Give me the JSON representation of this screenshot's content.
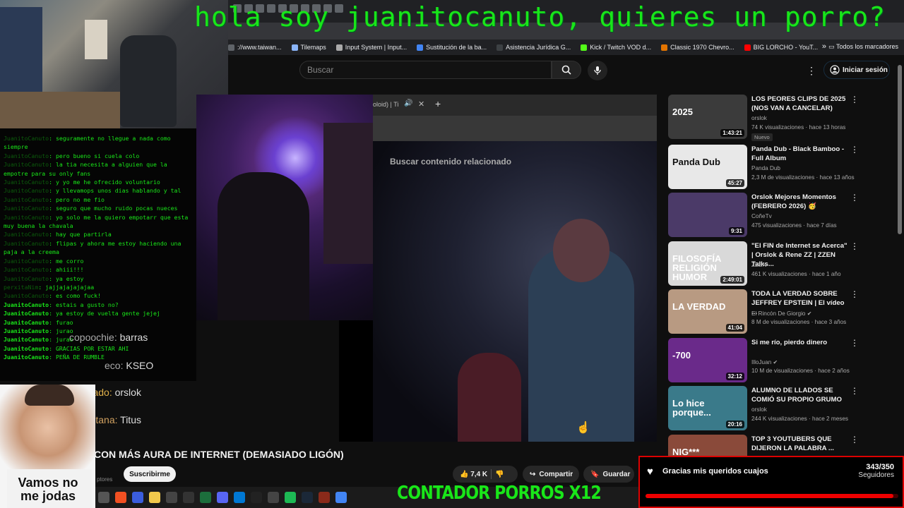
{
  "overlay_title": "hola soy juanitocanuto, quieres un porro?",
  "browser": {
    "bookmarks": [
      {
        "label": "://www.taiwan...",
        "color": "#5f6368"
      },
      {
        "label": "Tilemaps",
        "color": "#8ab4f8"
      },
      {
        "label": "Input System | Input...",
        "color": "#aaaaaa"
      },
      {
        "label": "Sustitución de la ba...",
        "color": "#4285f4"
      },
      {
        "label": "Asistencia Jurídica G...",
        "color": "#3c4043"
      },
      {
        "label": "Kick / Twitch VOD d...",
        "color": "#53fc18"
      },
      {
        "label": "Classic 1970 Chevro...",
        "color": "#e37400"
      },
      {
        "label": "BIG LORCHO - YouT...",
        "color": "#ff0000"
      }
    ],
    "more": "»",
    "all_bookmarks": "Todos los marcadores"
  },
  "youtube": {
    "search_placeholder": "Buscar",
    "signin": "Iniciar sesión",
    "video_title": "ANO CON MÁS AURA DE INTERNET (DEMASIADO LIGÓN)",
    "subscribe": "Suscribirme",
    "subscribers_fragment": "ptores",
    "likes": "7,4 K",
    "share": "Compartir",
    "save": "Guardar"
  },
  "video": {
    "inner_tab": "oloid) | Ti",
    "related_search": "Buscar contenido relacionado"
  },
  "chat": [
    {
      "user": "JuanitoCanuto",
      "bright": false,
      "text": ": seguramente no llegue a nada como siempre"
    },
    {
      "user": "JuanitoCanuto",
      "bright": false,
      "text": ": pero bueno si cuela colo"
    },
    {
      "user": "JuanitoCanuto",
      "bright": false,
      "text": ": la tia necesita a alguien que la empotre para su only fans"
    },
    {
      "user": "JuanitoCanuto",
      "bright": false,
      "text": ": y yo me he ofrecido voluntario"
    },
    {
      "user": "JuanitoCanuto",
      "bright": false,
      "text": ": y llevamops unos dias hablando y tal"
    },
    {
      "user": "JuanitoCanuto",
      "bright": false,
      "text": ": pero no me fio"
    },
    {
      "user": "JuanitoCanuto",
      "bright": false,
      "text": ": seguro que mucho ruido pocas nueces"
    },
    {
      "user": "JuanitoCanuto",
      "bright": false,
      "text": ": yo solo me la quiero empotarr que esta muy buena la chavala"
    },
    {
      "user": "JuanitoCanuto",
      "bright": false,
      "text": ": hay que partirla"
    },
    {
      "user": "JuanitoCanuto",
      "bright": false,
      "text": ": flipas y ahora me estoy haciendo una paja a la creema"
    },
    {
      "user": "JuanitoCanuto",
      "bright": false,
      "text": ": me corro"
    },
    {
      "user": "JuanitoCanuto",
      "bright": false,
      "text": ": ahiii!!!"
    },
    {
      "user": "JuanitoCanuto",
      "bright": false,
      "text": ": ya estoy"
    },
    {
      "user": "perxitaNim",
      "bright": false,
      "text": ": jajjajajajajaa"
    },
    {
      "user": "JuanitoCanuto",
      "bright": false,
      "text": ": es como fuck!"
    },
    {
      "user": "JuanitoCanuto",
      "bright": true,
      "text": ": estais a gusto no?"
    },
    {
      "user": "JuanitoCanuto",
      "bright": true,
      "text": ": ya estoy de vuelta gente jejej"
    },
    {
      "user": "JuanitoCanuto",
      "bright": true,
      "text": ": furao"
    },
    {
      "user": "JuanitoCanuto",
      "bright": true,
      "text": ": jurao"
    },
    {
      "user": "JuanitoCanuto",
      "bright": true,
      "text": ": jurao"
    },
    {
      "user": "JuanitoCanuto",
      "bright": true,
      "text": ": GRACIAS POR ESTAR AHI"
    },
    {
      "user": "JuanitoCanuto",
      "bright": true,
      "text": ": PEÑA DE RUMBLE"
    }
  ],
  "overlay_chat": [
    {
      "name": "copoochie:",
      "msg": "barras"
    },
    {
      "name": "eco:",
      "msg": "KSEO"
    },
    {
      "name": "eoxidado:",
      "msg": "orslok"
    },
    {
      "name": "nja_gitana:",
      "msg": "Titus"
    }
  ],
  "facecam_caption": "Vamos no me jodas",
  "recommendations": [
    {
      "title": "LOS PEORES CLIPS DE 2025 (NOS VAN A CANCELAR)",
      "channel": "orslok",
      "meta": "74 K visualizaciones · hace 13 horas",
      "duration": "1:43:21",
      "badge": "Nuevo",
      "thumb_text": "2025",
      "color": "#3b3b3b"
    },
    {
      "title": "Panda Dub - Black Bamboo - Full Album",
      "channel": "Panda Dub",
      "meta": "2,3 M de visualizaciones · hace 13 años",
      "duration": "45:27",
      "badge": "",
      "thumb_text": "Panda Dub",
      "color": "#e8e8e8"
    },
    {
      "title": "Orslok Mejores Momentos (FEBRERO 2026) 🥳",
      "channel": "CoñeTv",
      "meta": "475 visualizaciones · hace 7 días",
      "duration": "9:31",
      "badge": "",
      "thumb_text": "",
      "color": "#4b3a68"
    },
    {
      "title": "\"El FIN de Internet se Acerca\" | Orslok & Rene ZZ | ZZEN Talks...",
      "channel": "ZZEN",
      "meta": "461 K visualizaciones · hace 1 año",
      "duration": "2:49:01",
      "badge": "",
      "thumb_text": "FILOSOFÍA RELIGIÓN HUMOR",
      "color": "#d9d9d9"
    },
    {
      "title": "TODA LA VERDAD SOBRE JEFFREY EPSTEIN | El vídeo ...",
      "channel": "El Rincón De Giorgio ✔",
      "meta": "8 M de visualizaciones · hace 3 años",
      "duration": "41:04",
      "badge": "",
      "thumb_text": "LA VERDAD",
      "color": "#b89a82"
    },
    {
      "title": "Si me río, pierdo dinero",
      "channel": "IlloJuan ✔",
      "meta": "10 M de visualizaciones · hace 2 años",
      "duration": "32:12",
      "badge": "",
      "thumb_text": "-700",
      "color": "#6a2a8a"
    },
    {
      "title": "ALUMNO DE LLADOS SE COMIÓ SU PROPIO GRUMO",
      "channel": "orslok",
      "meta": "244 K visualizaciones · hace 2 meses",
      "duration": "20:16",
      "badge": "",
      "thumb_text": "Lo hice porque...",
      "color": "#3a7a8a"
    },
    {
      "title": "TOP 3 YOUTUBERS QUE DIJERON LA PALABRA ...",
      "channel": "",
      "meta": "",
      "duration": "",
      "badge": "",
      "thumb_text": "NIG***",
      "color": "#8a4a3a"
    }
  ],
  "widget": {
    "title": "Gracias mis queridos cuajos",
    "count": "343/350",
    "label": "Seguidores",
    "progress_percent": 98
  },
  "counter": "CONTADOR PORROS X12",
  "colors": {
    "overlay_green": "#19e619",
    "widget_red": "#dd0000",
    "youtube_bg": "#0f0f0f"
  }
}
